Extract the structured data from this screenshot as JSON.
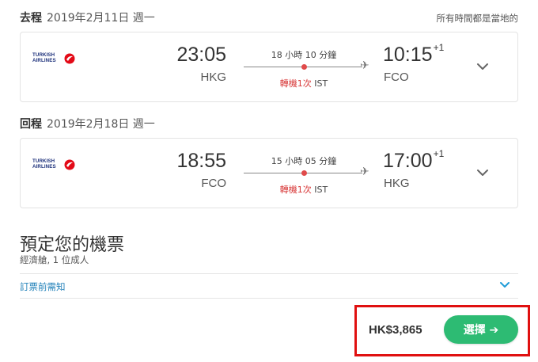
{
  "header": {
    "timezone_note": "所有時間都是當地的"
  },
  "outbound": {
    "label": "去程",
    "date": "2019年2月11日 週一",
    "airline": {
      "line1": "TURKISH",
      "line2": "AIRLINES"
    },
    "departure": {
      "time": "23:05",
      "code": "HKG"
    },
    "arrival": {
      "time": "10:15",
      "day_offset": "+1",
      "code": "FCO"
    },
    "duration": "18 小時 10 分鐘",
    "stops": {
      "label": "轉機1次",
      "airport": "IST"
    }
  },
  "inbound": {
    "label": "回程",
    "date": "2019年2月18日 週一",
    "airline": {
      "line1": "TURKISH",
      "line2": "AIRLINES"
    },
    "departure": {
      "time": "18:55",
      "code": "FCO"
    },
    "arrival": {
      "time": "17:00",
      "day_offset": "+1",
      "code": "HKG"
    },
    "duration": "15 小時 05 分鐘",
    "stops": {
      "label": "轉機1次",
      "airport": "IST"
    }
  },
  "booking": {
    "title": "預定您的機票",
    "subtitle": "經濟艙, 1 位成人",
    "info_link": "訂票前需知",
    "price": "HK$3,865",
    "select_label": "選擇 ➔"
  },
  "colors": {
    "accent_green": "#2dbb73",
    "stop_red": "#d83a3a",
    "link_blue": "#1e7fb8",
    "highlight_red": "#e01010",
    "airline_red": "#e30a17"
  }
}
